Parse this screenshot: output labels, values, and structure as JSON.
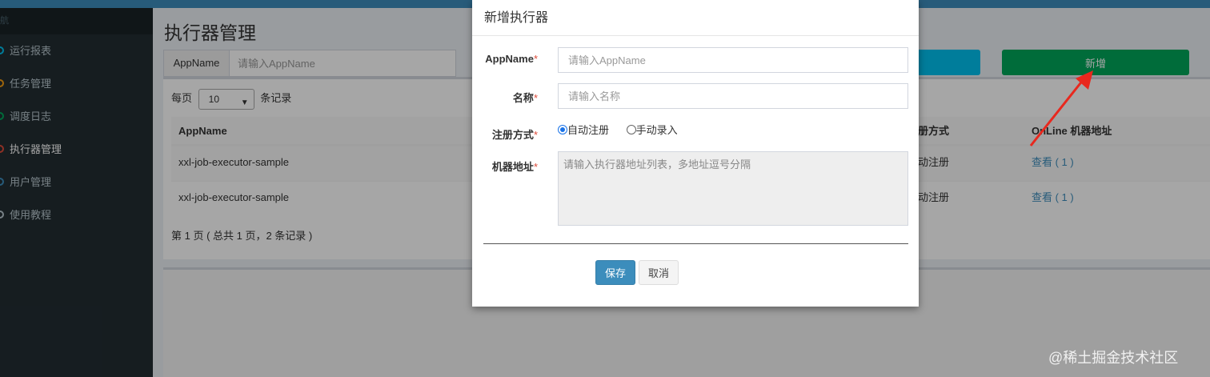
{
  "sidebar": {
    "header": "航",
    "items": [
      {
        "label": "运行报表",
        "color": "#00c0ef"
      },
      {
        "label": "任务管理",
        "color": "#f39c12"
      },
      {
        "label": "调度日志",
        "color": "#00a65a"
      },
      {
        "label": "执行器管理",
        "color": "#dd4b39"
      },
      {
        "label": "用户管理",
        "color": "#3c8dbc"
      },
      {
        "label": "使用教程",
        "color": "#b8c7ce"
      }
    ]
  },
  "page": {
    "title": "执行器管理",
    "search_addon": "AppName",
    "search_placeholder": "请输入AppName",
    "add_button": "新增"
  },
  "table": {
    "length_prefix": "每页",
    "length_value": "10",
    "length_suffix": "条记录",
    "columns": [
      "AppName",
      "注册方式",
      "OnLine 机器地址"
    ],
    "rows": [
      {
        "appname": "xxl-job-executor-sample",
        "register": "自动注册",
        "online": "查看 ( 1 )"
      },
      {
        "appname": "xxl-job-executor-sample",
        "register": "自动注册",
        "online": "查看 ( 1 )"
      }
    ],
    "page_info": "第 1 页 ( 总共 1 页，2 条记录 )"
  },
  "modal": {
    "title": "新增执行器",
    "appname_label": "AppName",
    "appname_placeholder": "请输入AppName",
    "name_label": "名称",
    "name_placeholder": "请输入名称",
    "register_label": "注册方式",
    "radio_auto": "自动注册",
    "radio_manual": "手动录入",
    "address_label": "机器地址",
    "address_placeholder": "请输入执行器地址列表，多地址逗号分隔",
    "required_mark": "*",
    "save_button": "保存",
    "cancel_button": "取消"
  },
  "watermark": "@稀土掘金技术社区"
}
